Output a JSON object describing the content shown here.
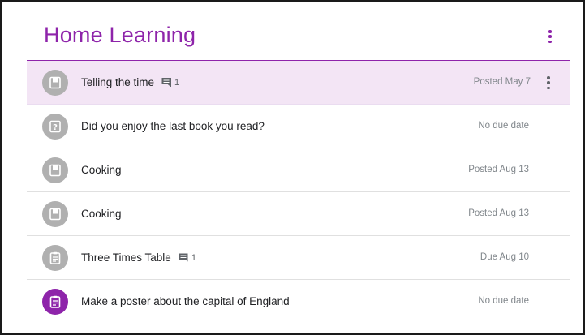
{
  "header": {
    "title": "Home Learning",
    "accent_color": "#8e24aa"
  },
  "items": [
    {
      "title": "Telling the time",
      "comments": "1",
      "date": "Posted May 7",
      "icon": "material-icon",
      "selected": true
    },
    {
      "title": "Did you enjoy the last book you read?",
      "comments": "",
      "date": "No due date",
      "icon": "question-icon",
      "selected": false
    },
    {
      "title": "Cooking",
      "comments": "",
      "date": "Posted Aug 13",
      "icon": "material-icon",
      "selected": false
    },
    {
      "title": "Cooking",
      "comments": "",
      "date": "Posted Aug 13",
      "icon": "material-icon",
      "selected": false
    },
    {
      "title": "Three Times Table",
      "comments": "1",
      "date": "Due Aug 10",
      "icon": "assignment-icon",
      "selected": false
    },
    {
      "title": "Make a poster about the capital of England",
      "comments": "",
      "date": "No due date",
      "icon": "assignment-icon",
      "selected": false,
      "highlight_color": "#8e24aa"
    }
  ]
}
